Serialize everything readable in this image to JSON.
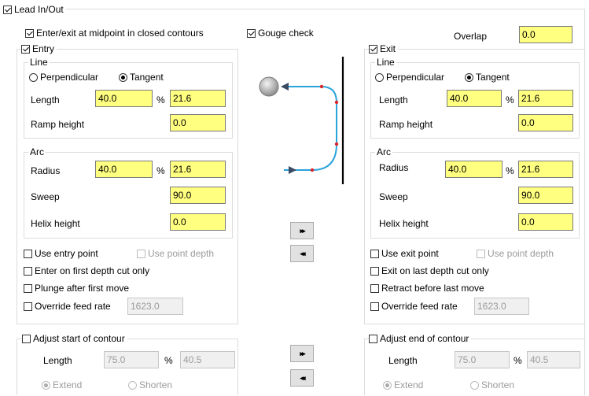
{
  "lead": {
    "title": "Lead In/Out",
    "midpoint_label": "Enter/exit at midpoint in closed contours",
    "gouge_label": "Gouge check",
    "overlap_label": "Overlap",
    "overlap_value": "0.0",
    "lead_checked": true,
    "midpoint_checked": true,
    "gouge_checked": true
  },
  "entry": {
    "title": "Entry",
    "checked": true,
    "line": {
      "title": "Line",
      "perpendicular": "Perpendicular",
      "tangent": "Tangent",
      "selected": "Tangent",
      "length_label": "Length",
      "length_pct": "40.0",
      "pct_symbol": "%",
      "length_value": "21.6",
      "ramp_label": "Ramp height",
      "ramp_value": "0.0"
    },
    "arc": {
      "title": "Arc",
      "radius_label": "Radius",
      "radius_pct": "40.0",
      "pct_symbol": "%",
      "radius_value": "21.6",
      "sweep_label": "Sweep",
      "sweep_value": "90.0",
      "helix_label": "Helix height",
      "helix_value": "0.0"
    },
    "use_point_label": "Use entry point",
    "use_depth_label": "Use point depth",
    "first_depth_label": "Enter on first depth cut only",
    "plunge_label": "Plunge after first move",
    "override_label": "Override feed rate",
    "override_value": "1623.0"
  },
  "exit": {
    "title": "Exit",
    "checked": true,
    "line": {
      "title": "Line",
      "perpendicular": "Perpendicular",
      "tangent": "Tangent",
      "selected": "Tangent",
      "length_label": "Length",
      "length_pct": "40.0",
      "pct_symbol": "%",
      "length_value": "21.6",
      "ramp_label": "Ramp height",
      "ramp_value": "0.0"
    },
    "arc": {
      "title": "Arc",
      "radius_label": "Radius",
      "radius_pct": "40.0",
      "pct_symbol": "%",
      "radius_value": "21.6",
      "sweep_label": "Sweep",
      "sweep_value": "90.0",
      "helix_label": "Helix height",
      "helix_value": "0.0"
    },
    "use_point_label": "Use exit point",
    "use_depth_label": "Use point depth",
    "last_depth_label": "Exit on last depth cut only",
    "retract_label": "Retract before last move",
    "override_label": "Override feed rate",
    "override_value": "1623.0"
  },
  "adjust_start": {
    "title": "Adjust start of contour",
    "length_label": "Length",
    "length_pct": "75.0",
    "pct_symbol": "%",
    "length_value": "40.5",
    "extend": "Extend",
    "shorten": "Shorten"
  },
  "adjust_end": {
    "title": "Adjust end of contour",
    "length_label": "Length",
    "length_pct": "75.0",
    "pct_symbol": "%",
    "length_value": "40.5",
    "extend": "Extend",
    "shorten": "Shorten"
  },
  "buttons": {
    "copy_right": "▸▸",
    "copy_left": "◂◂"
  },
  "colors": {
    "input_bg": "#ffff80",
    "toolpath": "#29a3dc",
    "marker": "#d9252a"
  }
}
